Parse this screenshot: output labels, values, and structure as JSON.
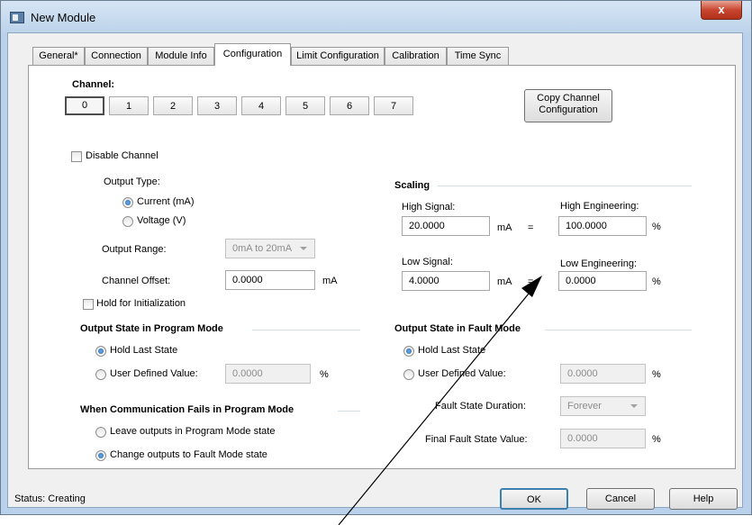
{
  "window": {
    "title": "New Module",
    "close_glyph": "x"
  },
  "tabs": [
    "General*",
    "Connection",
    "Module Info",
    "Configuration",
    "Limit Configuration",
    "Calibration",
    "Time Sync"
  ],
  "active_tab": "Configuration",
  "channel": {
    "label": "Channel:",
    "buttons": [
      "0",
      "1",
      "2",
      "3",
      "4",
      "5",
      "6",
      "7"
    ],
    "selected": "0",
    "copy_button": [
      "Copy Channel",
      "Configuration"
    ]
  },
  "disable_channel": {
    "label": "Disable Channel",
    "checked": false
  },
  "output_type": {
    "label": "Output Type:",
    "options": [
      "Current (mA)",
      "Voltage (V)"
    ],
    "selected": "Current (mA)"
  },
  "output_range": {
    "label": "Output Range:",
    "value": "0mA to 20mA"
  },
  "channel_offset": {
    "label": "Channel Offset:",
    "value": "0.0000",
    "unit": "mA"
  },
  "hold_for_init": {
    "label": "Hold for Initialization",
    "checked": false
  },
  "scaling": {
    "title": "Scaling",
    "high_signal_label": "High Signal:",
    "high_signal": "20.0000",
    "high_signal_unit": "mA",
    "high_eng_label": "High Engineering:",
    "high_eng": "100.0000",
    "high_eng_unit": "%",
    "low_signal_label": "Low Signal:",
    "low_signal": "4.0000",
    "low_signal_unit": "mA",
    "low_eng_label": "Low Engineering:",
    "low_eng": "0.0000",
    "low_eng_unit": "%",
    "equals": "="
  },
  "program_mode": {
    "title": "Output State in Program Mode",
    "hold_last": "Hold Last State",
    "user_defined": "User Defined Value:",
    "user_value": "0.0000",
    "unit": "%",
    "selected": "Hold Last State"
  },
  "fault_mode": {
    "title": "Output State in Fault Mode",
    "hold_last": "Hold Last State",
    "user_defined": "User Defined Value:",
    "user_value": "0.0000",
    "unit": "%",
    "duration_label": "Fault State Duration:",
    "duration": "Forever",
    "final_label": "Final Fault State Value:",
    "final_value": "0.0000",
    "final_unit": "%",
    "selected": "Hold Last State"
  },
  "comm_fail": {
    "title": "When Communication Fails in Program Mode",
    "options": [
      "Leave outputs in Program Mode state",
      "Change outputs to Fault Mode state"
    ],
    "selected": "Change outputs to Fault Mode state"
  },
  "status": {
    "text": "Status:  Creating"
  },
  "footer_buttons": {
    "ok": "OK",
    "cancel": "Cancel",
    "help": "Help"
  },
  "colors": {
    "title_bar": "#bcd3ea",
    "close": "#c8462f",
    "radio_dot": "#1f5fa8"
  }
}
